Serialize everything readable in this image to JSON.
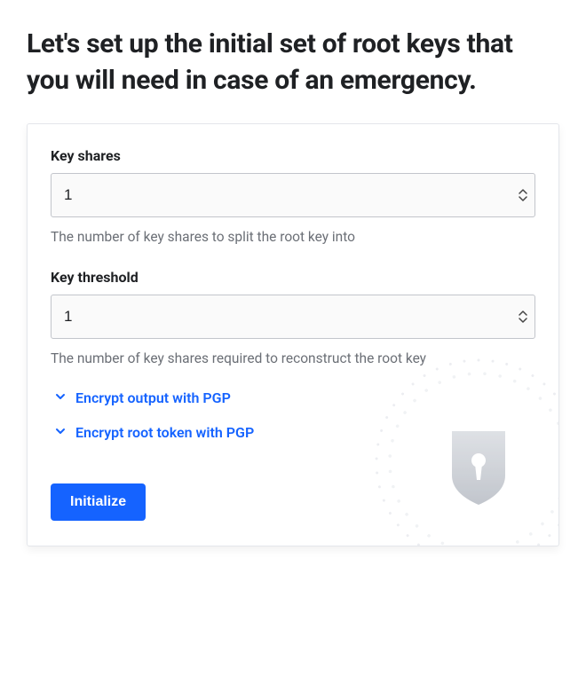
{
  "page": {
    "title": "Let's set up the initial set of root keys that you will need in case of an emergency."
  },
  "form": {
    "key_shares": {
      "label": "Key shares",
      "value": "1",
      "helper": "The number of key shares to split the root key into"
    },
    "key_threshold": {
      "label": "Key threshold",
      "value": "1",
      "helper": "The number of key shares required to reconstruct the root key"
    },
    "toggles": {
      "encrypt_output": "Encrypt output with PGP",
      "encrypt_root_token": "Encrypt root token with PGP"
    },
    "actions": {
      "initialize": "Initialize"
    }
  }
}
